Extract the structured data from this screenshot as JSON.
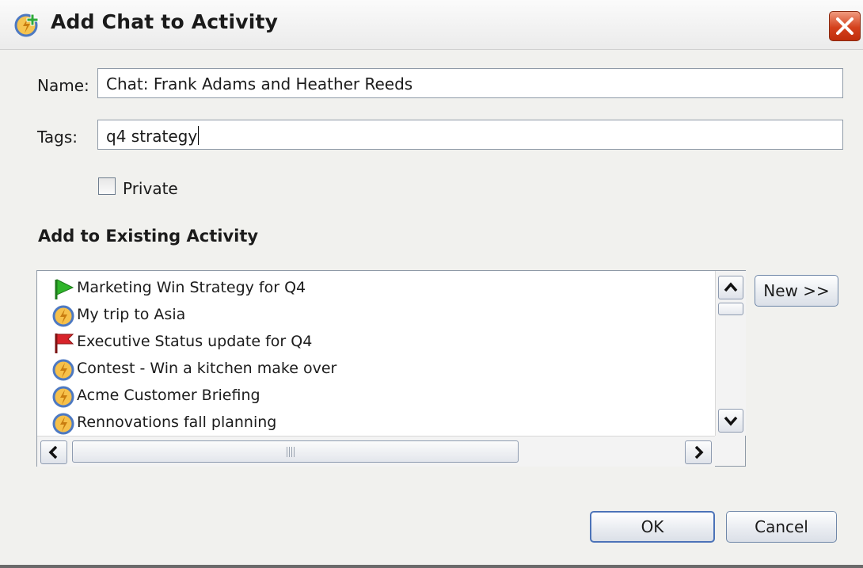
{
  "dialog": {
    "title": "Add Chat to Activity",
    "close_icon": "close-icon"
  },
  "form": {
    "name_label": "Name:",
    "name_value": "Chat: Frank Adams and Heather Reeds",
    "tags_label": "Tags:",
    "tags_value": "q4 strategy",
    "private_label": "Private",
    "private_checked": false
  },
  "existing": {
    "heading": "Add to Existing Activity",
    "items": [
      {
        "label": "Marketing Win Strategy for Q4",
        "icon": "green-flag-icon"
      },
      {
        "label": "My trip to Asia",
        "icon": "activity-bolt-icon"
      },
      {
        "label": "Executive Status update for Q4",
        "icon": "red-flag-icon"
      },
      {
        "label": "Contest - Win a kitchen make over",
        "icon": "activity-bolt-icon"
      },
      {
        "label": "Acme Customer Briefing",
        "icon": "activity-bolt-icon"
      },
      {
        "label": "Rennovations fall planning",
        "icon": "activity-bolt-icon"
      }
    ],
    "new_button": "New >>"
  },
  "footer": {
    "ok": "OK",
    "cancel": "Cancel"
  },
  "colors": {
    "close_button": "#d4411d",
    "default_button_border": "#4c73b8",
    "activity_icon": "#f2b233",
    "green_flag": "#2fb52a",
    "red_flag": "#d8232a"
  }
}
